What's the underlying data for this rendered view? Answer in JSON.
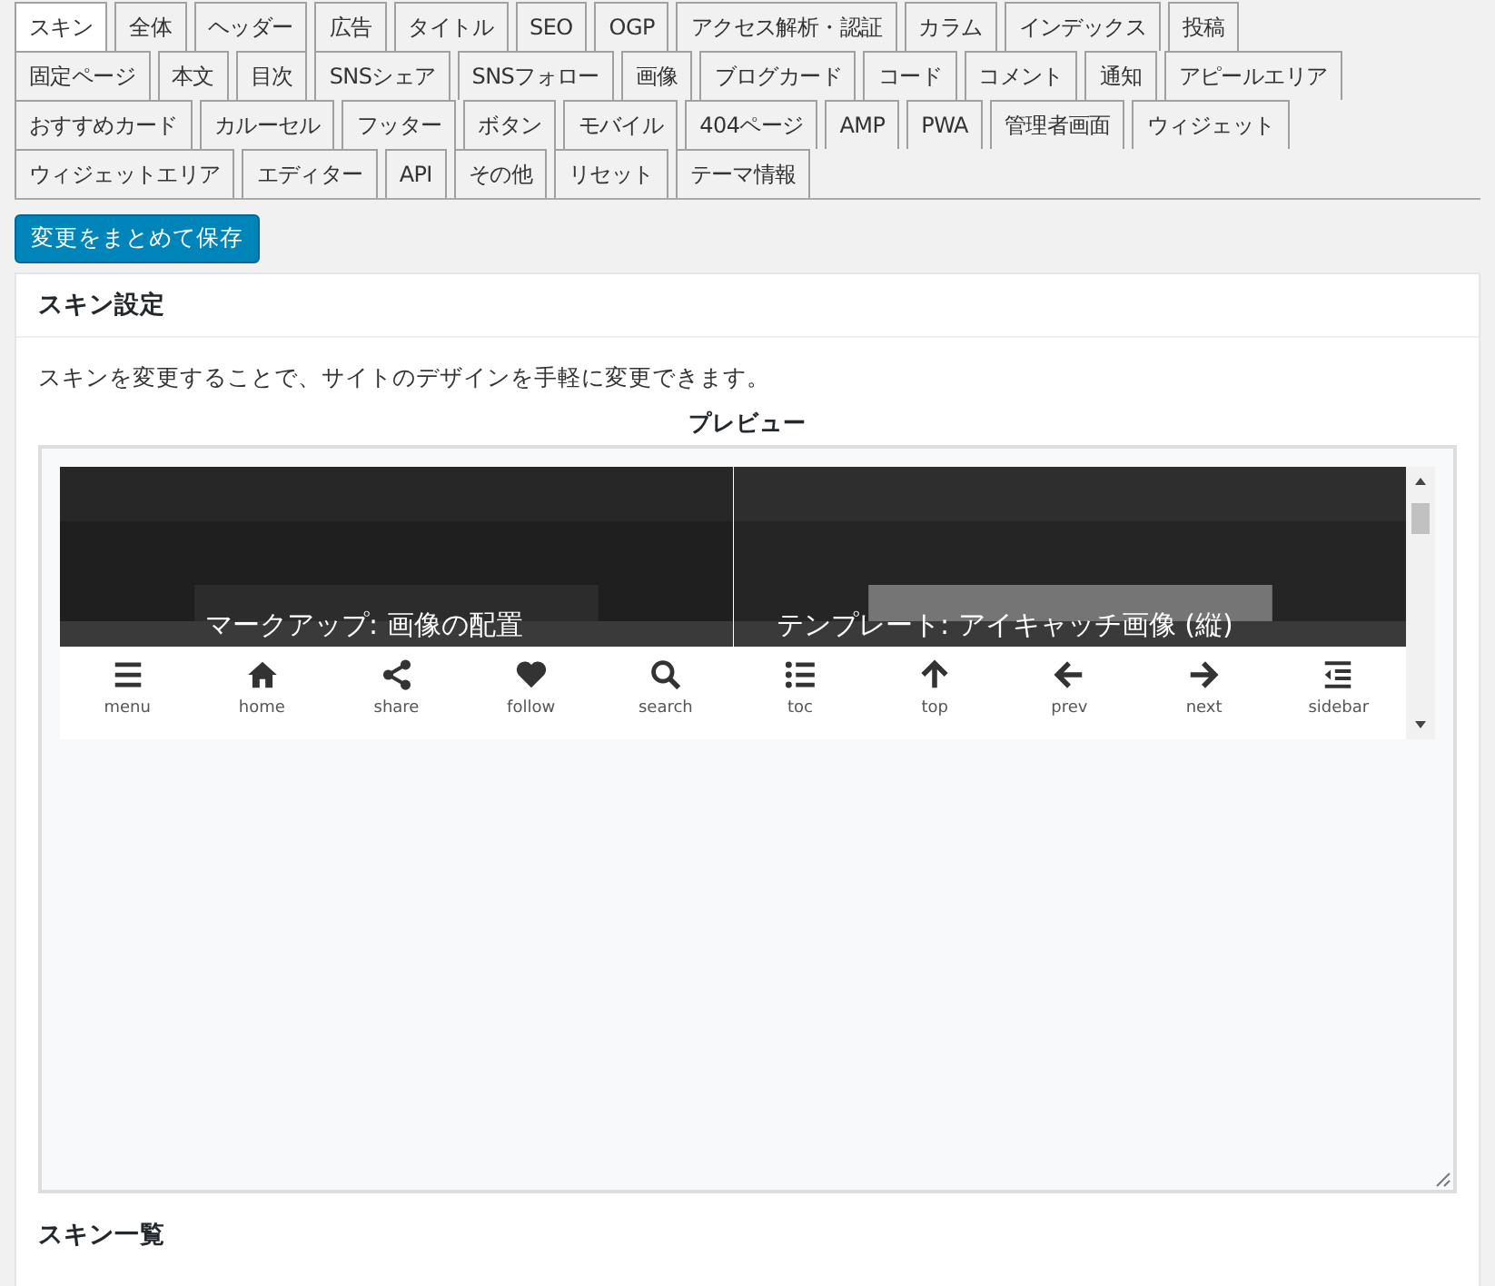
{
  "tab_rows": [
    [
      {
        "label": "スキン",
        "selected": true
      },
      {
        "label": "全体",
        "selected": false
      },
      {
        "label": "ヘッダー",
        "selected": false
      },
      {
        "label": "広告",
        "selected": false
      },
      {
        "label": "タイトル",
        "selected": false
      },
      {
        "label": "SEO",
        "selected": false
      },
      {
        "label": "OGP",
        "selected": false
      },
      {
        "label": "アクセス解析・認証",
        "selected": false
      },
      {
        "label": "カラム",
        "selected": false
      },
      {
        "label": "インデックス",
        "selected": false
      },
      {
        "label": "投稿",
        "selected": false
      }
    ],
    [
      {
        "label": "固定ページ",
        "selected": false
      },
      {
        "label": "本文",
        "selected": false
      },
      {
        "label": "目次",
        "selected": false
      },
      {
        "label": "SNSシェア",
        "selected": false
      },
      {
        "label": "SNSフォロー",
        "selected": false
      },
      {
        "label": "画像",
        "selected": false
      },
      {
        "label": "ブログカード",
        "selected": false
      },
      {
        "label": "コード",
        "selected": false
      },
      {
        "label": "コメント",
        "selected": false
      },
      {
        "label": "通知",
        "selected": false
      },
      {
        "label": "アピールエリア",
        "selected": false
      }
    ],
    [
      {
        "label": "おすすめカード",
        "selected": false
      },
      {
        "label": "カルーセル",
        "selected": false
      },
      {
        "label": "フッター",
        "selected": false
      },
      {
        "label": "ボタン",
        "selected": false
      },
      {
        "label": "モバイル",
        "selected": false
      },
      {
        "label": "404ページ",
        "selected": false
      },
      {
        "label": "AMP",
        "selected": false
      },
      {
        "label": "PWA",
        "selected": false
      },
      {
        "label": "管理者画面",
        "selected": false
      },
      {
        "label": "ウィジェット",
        "selected": false
      }
    ],
    [
      {
        "label": "ウィジェットエリア",
        "selected": false
      },
      {
        "label": "エディター",
        "selected": false
      },
      {
        "label": "API",
        "selected": false
      },
      {
        "label": "その他",
        "selected": false
      },
      {
        "label": "リセット",
        "selected": false
      },
      {
        "label": "テーマ情報",
        "selected": false
      }
    ]
  ],
  "save_button": "変更をまとめて保存",
  "panel": {
    "title": "スキン設定",
    "description": "スキンを変更することで、サイトのデザインを手軽に変更できます。",
    "preview": {
      "heading": "プレビュー",
      "cards": [
        {
          "title": "マークアップ: 画像の配置"
        },
        {
          "title": "テンプレート: アイキャッチ画像 (縦)"
        }
      ],
      "mobile_buttons": [
        {
          "kind": "menu",
          "label": "menu"
        },
        {
          "kind": "home",
          "label": "home"
        },
        {
          "kind": "share",
          "label": "share"
        },
        {
          "kind": "follow",
          "label": "follow"
        },
        {
          "kind": "search",
          "label": "search"
        },
        {
          "kind": "toc",
          "label": "toc"
        },
        {
          "kind": "top",
          "label": "top"
        },
        {
          "kind": "prev",
          "label": "prev"
        },
        {
          "kind": "next",
          "label": "next"
        },
        {
          "kind": "sidebar",
          "label": "sidebar"
        }
      ]
    }
  },
  "next_section_title": "スキン一覧"
}
